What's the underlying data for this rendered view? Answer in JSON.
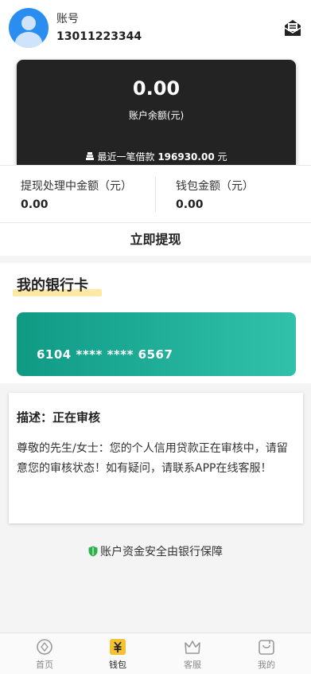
{
  "account": {
    "label": "账号",
    "phone": "13011223344"
  },
  "balance": {
    "amount": "0.00",
    "label": "账户余额(元)",
    "recent_prefix": "最近一笔借款",
    "recent_amount": "196930.00",
    "recent_unit": "元"
  },
  "stats": {
    "processing_label": "提现处理中金额（元）",
    "processing_value": "0.00",
    "wallet_label": "钱包金额（元）",
    "wallet_value": "0.00"
  },
  "withdraw_label": "立即提现",
  "bank": {
    "title": "我的银行卡",
    "card_number": "6104 **** **** 6567"
  },
  "description": {
    "title": "描述：正在审核",
    "body": "尊敬的先生/女士：您的个人信用贷款正在审核中，请留意您的审核状态！如有疑问，请联系APP在线客服！"
  },
  "security_text": "账户资金安全由银行保障",
  "nav": {
    "items": [
      {
        "label": "首页",
        "icon": "home-icon",
        "active": false
      },
      {
        "label": "钱包",
        "icon": "wallet-icon",
        "active": true
      },
      {
        "label": "客服",
        "icon": "service-icon",
        "active": false
      },
      {
        "label": "我的",
        "icon": "profile-icon",
        "active": false
      }
    ]
  },
  "colors": {
    "balance_card": "#232323",
    "bank_card_start": "#0f9a84",
    "bank_card_end": "#31c1ab",
    "wallet_active": "#f2c230",
    "avatar": "#2a8ef0",
    "shield": "#2bb24c"
  }
}
